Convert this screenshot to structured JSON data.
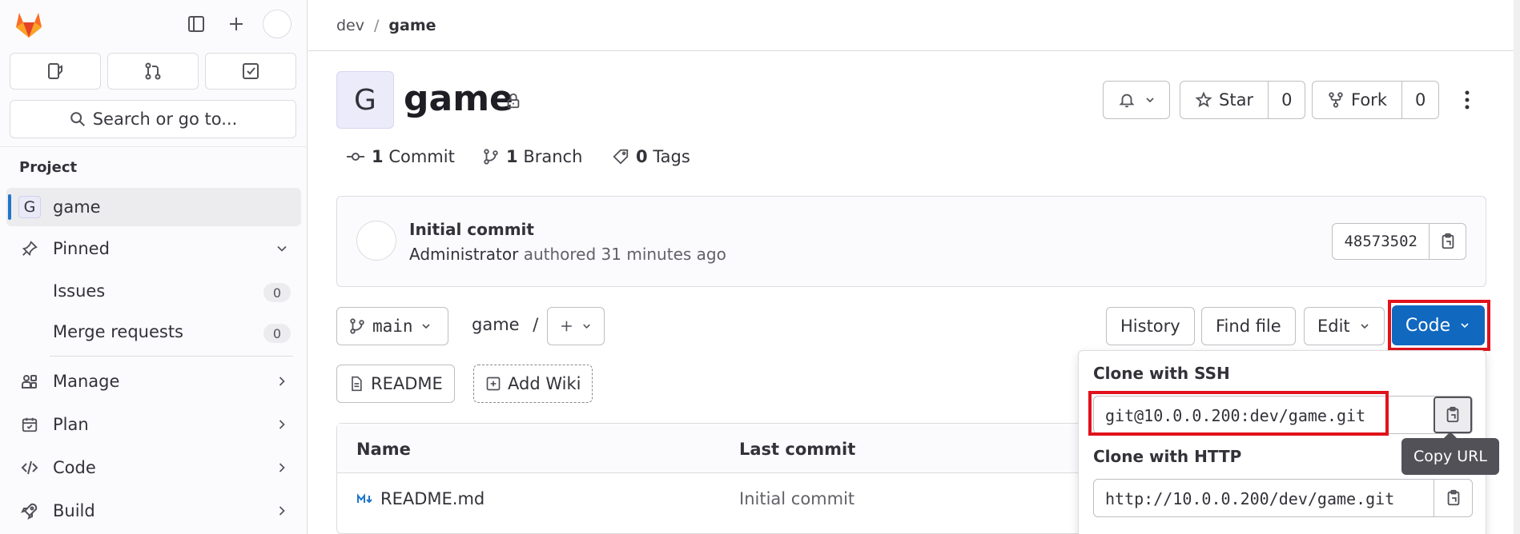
{
  "colors": {
    "accent": "#1068bf",
    "highlight": "#e0121b",
    "active_indicator": "#1f75cb"
  },
  "sidebar": {
    "search_label": "Search or go to...",
    "section_label": "Project",
    "project": {
      "avatar_letter": "G",
      "name": "game"
    },
    "pinned": {
      "label": "Pinned",
      "items": [
        {
          "label": "Issues",
          "count": "0"
        },
        {
          "label": "Merge requests",
          "count": "0"
        }
      ]
    },
    "nav": [
      {
        "label": "Manage",
        "icon": "users-icon"
      },
      {
        "label": "Plan",
        "icon": "calendar-icon"
      },
      {
        "label": "Code",
        "icon": "code-icon"
      },
      {
        "label": "Build",
        "icon": "rocket-icon"
      }
    ]
  },
  "breadcrumb": {
    "parent": "dev",
    "separator": "/",
    "current": "game"
  },
  "project": {
    "avatar_letter": "G",
    "title": "game",
    "star_label": "Star",
    "star_count": "0",
    "fork_label": "Fork",
    "fork_count": "0"
  },
  "stats": {
    "commits_count": "1",
    "commits_label": "Commit",
    "branches_count": "1",
    "branches_label": "Branch",
    "tags_count": "0",
    "tags_label": "Tags"
  },
  "last_commit": {
    "title": "Initial commit",
    "author": "Administrator",
    "meta": "authored 31 minutes ago",
    "sha": "48573502"
  },
  "repo_toolbar": {
    "branch": "main",
    "path": "game",
    "path_sep": "/",
    "history_label": "History",
    "find_file_label": "Find file",
    "edit_label": "Edit",
    "code_label": "Code",
    "readme_label": "README",
    "add_wiki_label": "Add Wiki"
  },
  "file_table": {
    "headers": [
      "Name",
      "Last commit"
    ],
    "rows": [
      {
        "name": "README.md",
        "last_commit": "Initial commit"
      }
    ]
  },
  "clone_dropdown": {
    "ssh_label": "Clone with SSH",
    "ssh_url": "git@10.0.0.200:dev/game.git",
    "http_label": "Clone with HTTP",
    "http_url": "http://10.0.0.200/dev/game.git",
    "tooltip": "Copy URL"
  }
}
